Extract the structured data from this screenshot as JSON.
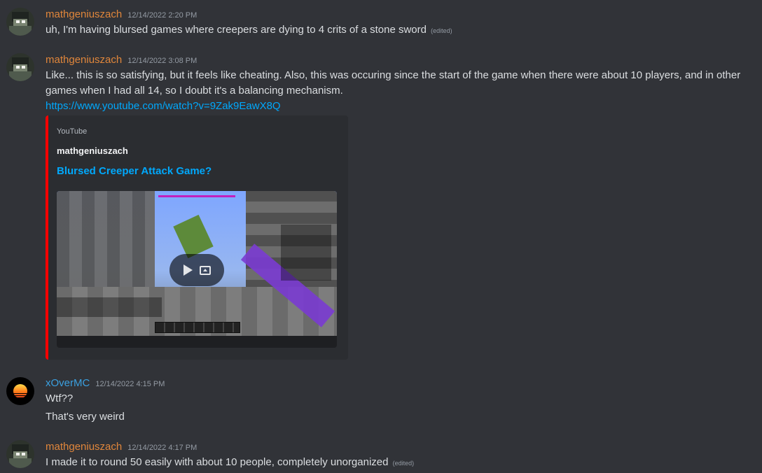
{
  "messages": [
    {
      "username": "mathgeniuszach",
      "timestamp": "12/14/2022 2:20 PM",
      "text": "uh, I'm having blursed games where creepers are dying to 4 crits of a stone sword",
      "edited": "(edited)"
    },
    {
      "username": "mathgeniuszach",
      "timestamp": "12/14/2022 3:08 PM",
      "text": "Like... this is so satisfying, but it feels like cheating. Also, this was occuring since the start of the game when there were about 10 players, and in other games when I had all 14, so I doubt it's a balancing mechanism.",
      "link": "https://www.youtube.com/watch?v=9Zak9EawX8Q",
      "embed": {
        "provider": "YouTube",
        "author": "mathgeniuszach",
        "title": "Blursed Creeper Attack Game?",
        "accent_color": "#ff0000"
      }
    },
    {
      "username": "xOverMC",
      "timestamp": "12/14/2022 4:15 PM",
      "lines": [
        "Wtf??",
        "That's very weird"
      ]
    },
    {
      "username": "mathgeniuszach",
      "timestamp": "12/14/2022 4:17 PM",
      "text": "I made it to round 50 easily with about 10 people, completely unorganized",
      "edited": "(edited)"
    }
  ],
  "icons": {
    "play": "play-icon",
    "popout": "popout-icon"
  },
  "colors": {
    "background": "#313338",
    "username_orange": "#e0863b",
    "username_blue": "#3ba0e0",
    "link": "#00a8fc"
  }
}
